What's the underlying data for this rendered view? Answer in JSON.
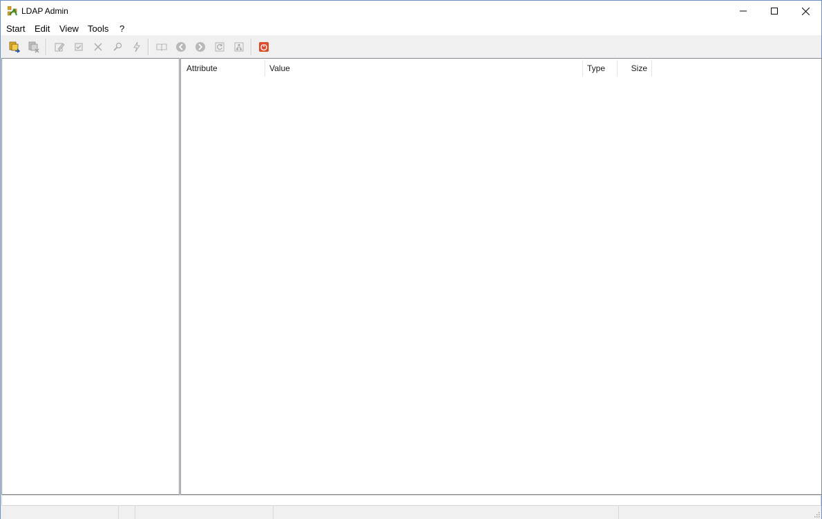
{
  "window": {
    "title": "LDAP Admin"
  },
  "menu": {
    "items": [
      "Start",
      "Edit",
      "View",
      "Tools",
      "?"
    ]
  },
  "toolbar": {
    "buttons": [
      {
        "name": "connect-icon",
        "enabled": true
      },
      {
        "name": "disconnect-icon",
        "enabled": false
      },
      {
        "name": "edit-entry-icon",
        "enabled": false
      },
      {
        "name": "save-icon",
        "enabled": false
      },
      {
        "name": "delete-icon",
        "enabled": false
      },
      {
        "name": "search-icon",
        "enabled": false
      },
      {
        "name": "lightning-icon",
        "enabled": false
      },
      {
        "name": "schema-book-icon",
        "enabled": false
      },
      {
        "name": "back-arrow-icon",
        "enabled": false
      },
      {
        "name": "forward-arrow-icon",
        "enabled": false
      },
      {
        "name": "refresh-icon",
        "enabled": false
      },
      {
        "name": "tree-icon",
        "enabled": false
      },
      {
        "name": "exit-power-icon",
        "enabled": true
      }
    ]
  },
  "attribute_list": {
    "columns": [
      "Attribute",
      "Value",
      "Type",
      "Size"
    ]
  },
  "colors": {
    "exit_button": "#e04a2a",
    "connect_icon": "#e8b020",
    "disabled_icon": "#a8a8a8"
  }
}
